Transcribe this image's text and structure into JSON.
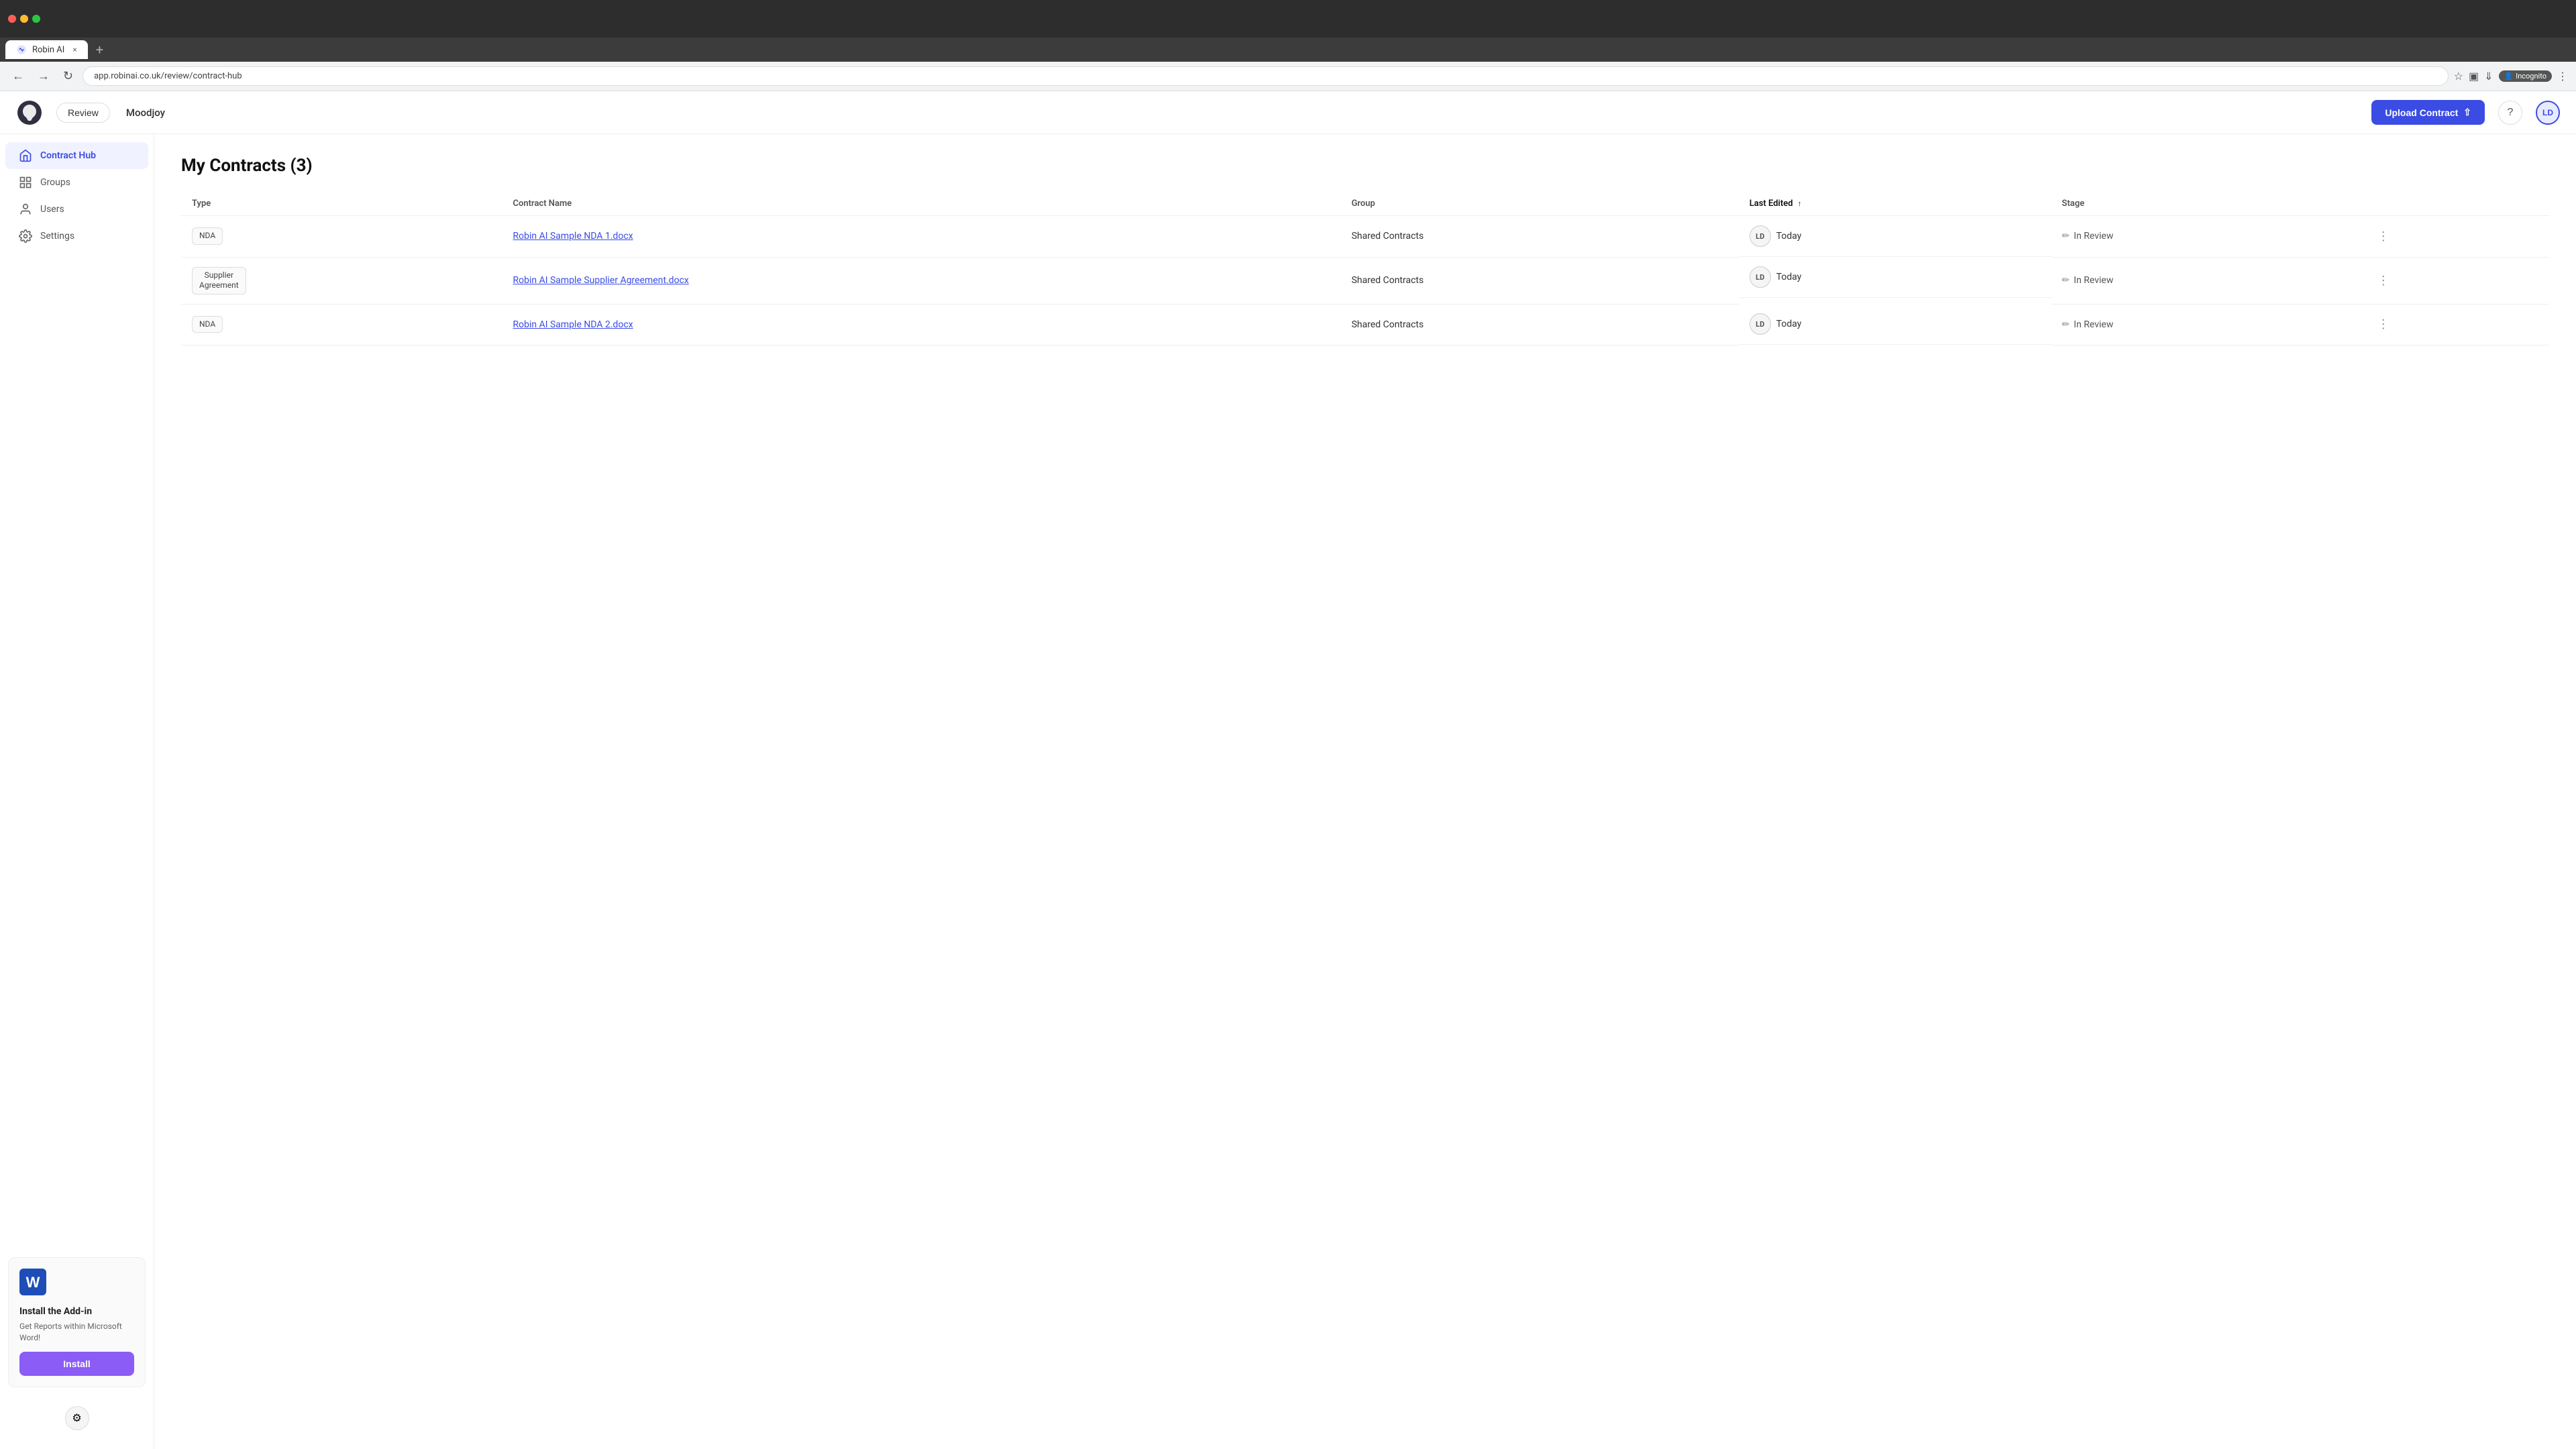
{
  "browser": {
    "tab_label": "Robin AI",
    "tab_close": "×",
    "tab_new": "+",
    "url": "app.robinai.co.uk/review/contract-hub",
    "incognito_label": "Incognito"
  },
  "nav": {
    "review_label": "Review",
    "company_name": "Moodjoy",
    "upload_button": "Upload Contract",
    "help_label": "?",
    "avatar_label": "LD"
  },
  "sidebar": {
    "items": [
      {
        "id": "contract-hub",
        "label": "Contract Hub",
        "active": true
      },
      {
        "id": "groups",
        "label": "Groups",
        "active": false
      },
      {
        "id": "users",
        "label": "Users",
        "active": false
      },
      {
        "id": "settings",
        "label": "Settings",
        "active": false
      }
    ],
    "addon": {
      "title": "Install the Add-in",
      "description": "Get Reports within Microsoft Word!",
      "install_label": "Install"
    }
  },
  "contracts": {
    "title": "My Contracts (3)",
    "columns": {
      "type": "Type",
      "name": "Contract Name",
      "group": "Group",
      "last_edited": "Last Edited",
      "stage": "Stage"
    },
    "rows": [
      {
        "type": "NDA",
        "name": "Robin AI Sample NDA 1.docx",
        "group": "Shared Contracts",
        "avatar": "LD",
        "last_edited": "Today",
        "stage": "In Review"
      },
      {
        "type": "Supplier\nAgreement",
        "name": "Robin AI Sample Supplier Agreement.docx",
        "group": "Shared Contracts",
        "avatar": "LD",
        "last_edited": "Today",
        "stage": "In Review"
      },
      {
        "type": "NDA",
        "name": "Robin AI Sample NDA 2.docx",
        "group": "Shared Contracts",
        "avatar": "LD",
        "last_edited": "Today",
        "stage": "In Review"
      }
    ]
  },
  "feedback_icon": "⚙"
}
